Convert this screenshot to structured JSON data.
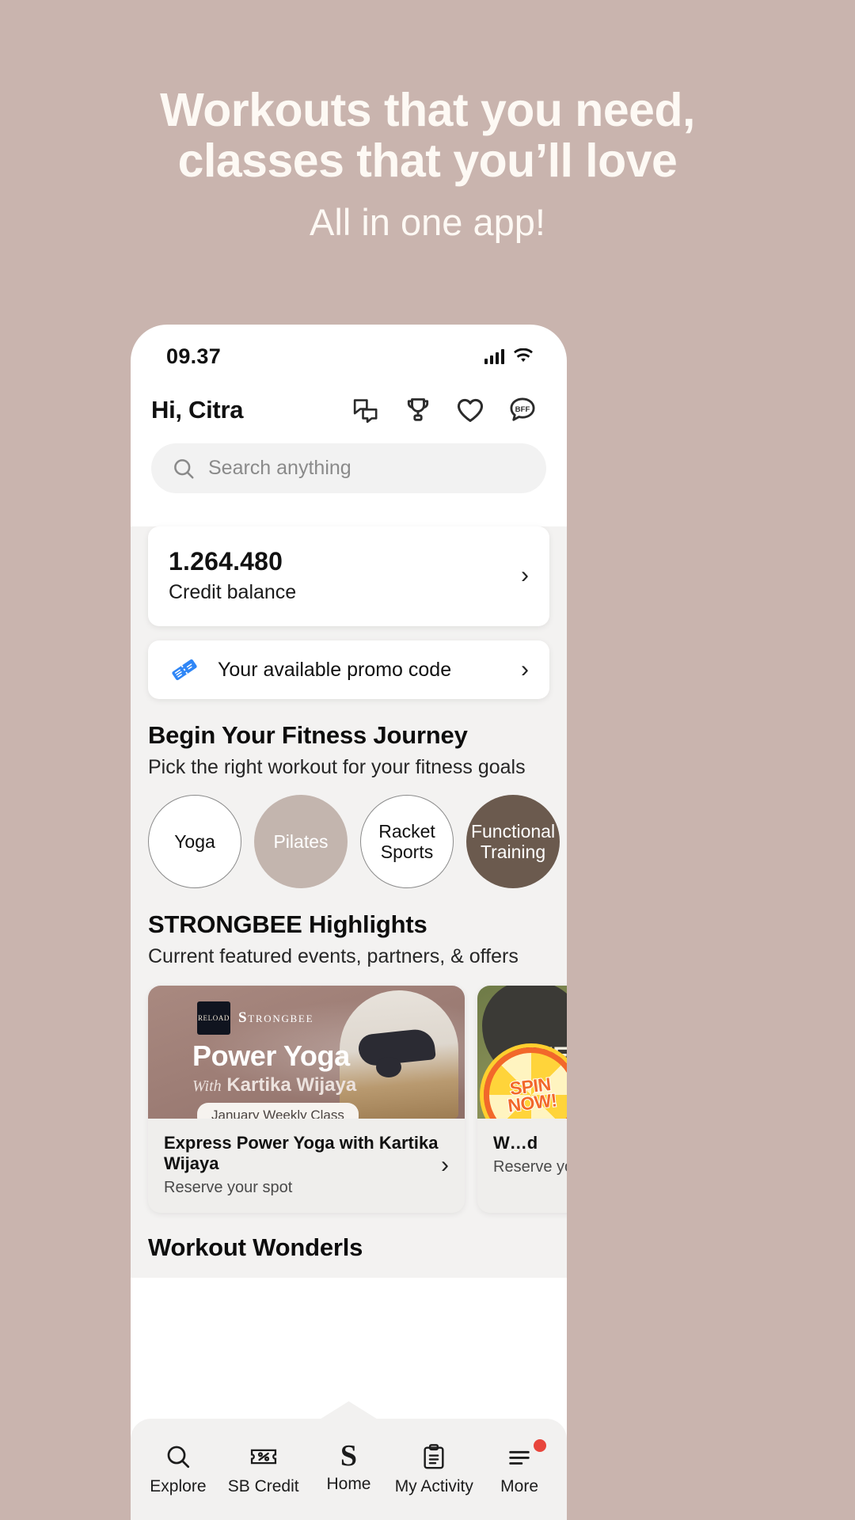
{
  "hero": {
    "line1": "Workouts that you need,",
    "line2": "classes that you’ll love",
    "line3": "All in one app!"
  },
  "status_bar": {
    "time": "09.37",
    "signal_icon": "signal-bars-icon",
    "wifi_icon": "wifi-icon"
  },
  "header": {
    "greeting": "Hi, Citra",
    "icons": [
      {
        "name": "chat-icon",
        "label": "Chat"
      },
      {
        "name": "trophy-icon",
        "label": "Trophy"
      },
      {
        "name": "heart-icon",
        "label": "Favorites"
      },
      {
        "name": "bff-icon",
        "label": "BFF"
      }
    ]
  },
  "search": {
    "placeholder": "Search anything",
    "icon": "search-icon"
  },
  "credit": {
    "amount": "1.264.480",
    "label": "Credit balance",
    "chevron": "›"
  },
  "promo": {
    "text": "Your available promo code",
    "icon": "ticket-icon",
    "chevron": "›"
  },
  "fitness_journey": {
    "title": "Begin Your Fitness Journey",
    "subtitle": "Pick the right workout for your fitness goals",
    "categories": [
      {
        "label": "Yoga",
        "style": "outline"
      },
      {
        "label": "Pilates",
        "style": "taupe"
      },
      {
        "label": "Racket Sports",
        "style": "outline"
      },
      {
        "label": "Functional Training",
        "style": "dark"
      },
      {
        "label": "",
        "style": "outline"
      }
    ]
  },
  "highlights": {
    "title": "STRONGBEE Highlights",
    "subtitle": "Current featured events, partners, & offers",
    "cards": [
      {
        "brand_box": "RELOAD",
        "brand_name": "TRONGBEE",
        "brand_initial": "S",
        "image_title": "Power Yoga",
        "image_with": "With",
        "image_instructor": "Kartika Wijaya",
        "pill": "January Weekly Class",
        "footer_title": "Express Power Yoga with Kartika Wijaya",
        "footer_sub": "Reserve your spot",
        "chevron": "›"
      },
      {
        "badge": "SPIN NOW!",
        "image_title": "WELL",
        "footer_title": "W…d",
        "footer_sub": "Reserve your boo",
        "chevron": "›"
      }
    ]
  },
  "next_section": {
    "title": "Workout Wonderls"
  },
  "bottom_nav": {
    "items": [
      {
        "label": "Explore",
        "icon": "search-icon",
        "badge": false
      },
      {
        "label": "SB Credit",
        "icon": "ticket-percent-icon",
        "badge": false
      },
      {
        "label": "Home",
        "icon": "strongbee-s-icon",
        "badge": false
      },
      {
        "label": "My Activity",
        "icon": "clipboard-icon",
        "badge": false
      },
      {
        "label": "More",
        "icon": "hamburger-icon",
        "badge": true
      }
    ]
  },
  "colors": {
    "background": "#c9b4ae",
    "taupe": "#c3b5ae",
    "dark_brown": "#6b5a4e",
    "badge_red": "#e8453c",
    "promo_blue": "#2f86f6"
  }
}
